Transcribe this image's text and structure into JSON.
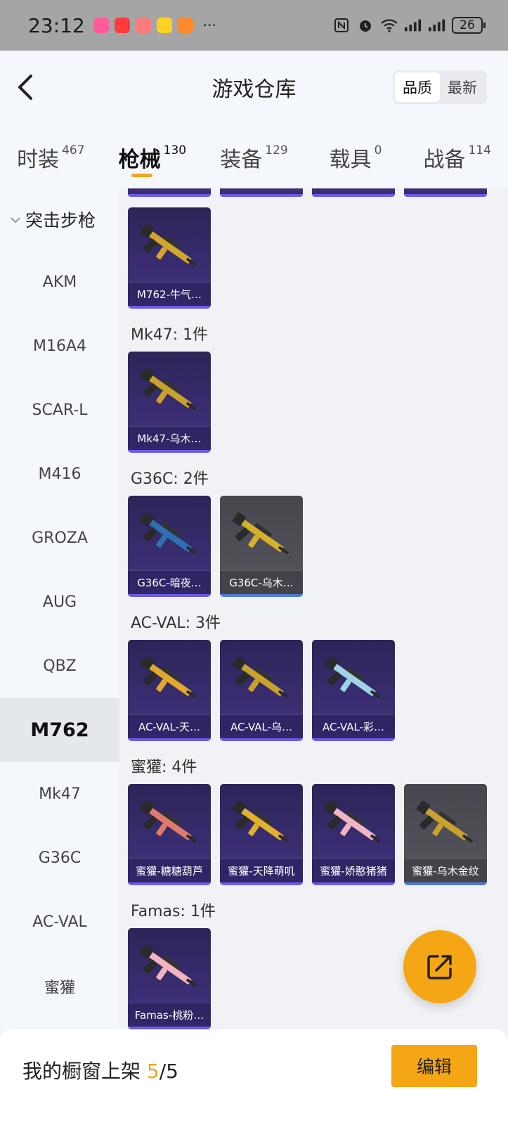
{
  "status_bar": {
    "time": "23:12",
    "battery": "26"
  },
  "header": {
    "title": "游戏仓库",
    "sort": [
      "品质",
      "最新"
    ],
    "active_sort": 0
  },
  "tabs": [
    {
      "label": "时装",
      "count": "467"
    },
    {
      "label": "枪械",
      "count": "130"
    },
    {
      "label": "装备",
      "count": "129"
    },
    {
      "label": "载具",
      "count": "0"
    },
    {
      "label": "战备",
      "count": "114"
    }
  ],
  "active_tab": 1,
  "sidebar": {
    "category": "突击步枪",
    "items": [
      "AKM",
      "M16A4",
      "SCAR-L",
      "M416",
      "GROZA",
      "AUG",
      "QBZ",
      "M762",
      "Mk47",
      "G36C",
      "AC-VAL",
      "蜜獾"
    ],
    "active_index": 7
  },
  "sections": [
    {
      "title": "",
      "items": [
        {
          "name": "M762-牛气…",
          "style": "purple",
          "gun_color": "#d2a62a"
        }
      ]
    },
    {
      "title": "Mk47: 1件",
      "items": [
        {
          "name": "Mk47-乌木…",
          "style": "purple",
          "gun_color": "#c9a22c"
        }
      ]
    },
    {
      "title": "G36C: 2件",
      "items": [
        {
          "name": "G36C-暗夜…",
          "style": "purple",
          "gun_color": "#2f6fb0"
        },
        {
          "name": "G36C-乌木…",
          "style": "gray",
          "gun_color": "#d4b12c"
        }
      ]
    },
    {
      "title": "AC-VAL: 3件",
      "items": [
        {
          "name": "AC-VAL-天…",
          "style": "purple",
          "gun_color": "#e1a92b"
        },
        {
          "name": "AC-VAL-乌…",
          "style": "purple",
          "gun_color": "#c9a22c"
        },
        {
          "name": "AC-VAL-彩…",
          "style": "purple",
          "gun_color": "#9ed3e6"
        }
      ]
    },
    {
      "title": "蜜獾: 4件",
      "items": [
        {
          "name": "蜜獾-糖糖葫芦",
          "style": "purple",
          "gun_color": "#e07a6a"
        },
        {
          "name": "蜜獾-天降萌叽",
          "style": "purple",
          "gun_color": "#e2b12e"
        },
        {
          "name": "蜜獾-娇憨猪猪",
          "style": "purple",
          "gun_color": "#f1b4c6"
        },
        {
          "name": "蜜獾-乌木金纹",
          "style": "gray",
          "gun_color": "#c8a22c"
        }
      ]
    },
    {
      "title": "Famas: 1件",
      "items": [
        {
          "name": "Famas-桃粉…",
          "style": "purple",
          "gun_color": "#f2b4bf"
        }
      ]
    }
  ],
  "bottom_bar": {
    "label": "我的橱窗上架",
    "current": "5",
    "total": "/5",
    "edit_label": "编辑"
  }
}
